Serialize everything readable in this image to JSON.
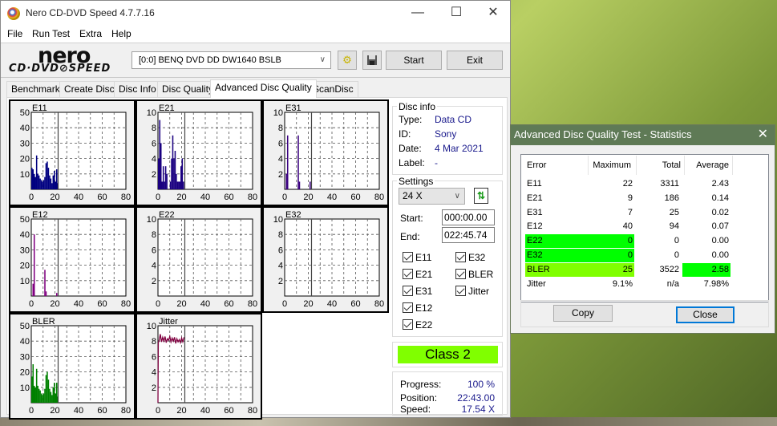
{
  "window": {
    "title": "Nero CD-DVD Speed 4.7.7.16",
    "controls": {
      "minimize": "—",
      "maximize": "☐",
      "close": "✕"
    }
  },
  "menu": [
    "File",
    "Run Test",
    "Extra",
    "Help"
  ],
  "toolbar": {
    "logo_top": "nero",
    "logo_bottom": "CD·DVD⊘SPEED",
    "drive": "[0:0]   BENQ DVD DD DW1640 BSLB",
    "icons": [
      "drive-refresh-icon",
      "save-icon"
    ],
    "start_label": "Start",
    "exit_label": "Exit"
  },
  "tabs": [
    {
      "label": "Benchmark",
      "active": false
    },
    {
      "label": "Create Disc",
      "active": false
    },
    {
      "label": "Disc Info",
      "active": false
    },
    {
      "label": "Disc Quality",
      "active": false
    },
    {
      "label": "Advanced Disc Quality",
      "active": true
    },
    {
      "label": "ScanDisc",
      "active": false
    }
  ],
  "disc_info": {
    "title": "Disc info",
    "type_label": "Type:",
    "type": "Data CD",
    "id_label": "ID:",
    "id": "Sony",
    "date_label": "Date:",
    "date": "4 Mar 2021",
    "label_label": "Label:",
    "label": "-"
  },
  "settings": {
    "title": "Settings",
    "speed": "24 X",
    "start_label": "Start:",
    "start": "000:00.00",
    "end_label": "End:",
    "end": "022:45.74",
    "checkboxes": [
      {
        "label": "E11",
        "checked": true
      },
      {
        "label": "E21",
        "checked": true
      },
      {
        "label": "E31",
        "checked": true
      },
      {
        "label": "E12",
        "checked": true
      },
      {
        "label": "E22",
        "checked": true
      },
      {
        "label": "E32",
        "checked": true
      },
      {
        "label": "BLER",
        "checked": true
      },
      {
        "label": "Jitter",
        "checked": true
      }
    ]
  },
  "class_badge": {
    "text": "Class 2",
    "color": "#80ff00"
  },
  "progress": {
    "progress_label": "Progress:",
    "progress": "100 %",
    "position_label": "Position:",
    "position": "22:43.00",
    "speed_label": "Speed:",
    "speed": "17.54 X"
  },
  "chart_data": [
    {
      "type": "bar",
      "title": "E11",
      "color": "#000080",
      "xlim": [
        0,
        80
      ],
      "ylim": [
        0,
        50
      ],
      "xticks": [
        "0",
        "20",
        "40",
        "60",
        "80"
      ],
      "yticks": [
        "10",
        "20",
        "30",
        "40",
        "50"
      ],
      "marker_x": 22.7,
      "x": [
        0,
        1,
        2,
        3,
        4,
        5,
        6,
        7,
        8,
        9,
        10,
        11,
        12,
        13,
        14,
        15,
        16,
        17,
        18,
        19,
        20,
        21,
        22
      ],
      "values": [
        14,
        13,
        10,
        8,
        22,
        10,
        9,
        7,
        6,
        5,
        6,
        8,
        17,
        18,
        14,
        9,
        7,
        4,
        9,
        12,
        5,
        13,
        4
      ]
    },
    {
      "type": "bar",
      "title": "E21",
      "color": "#1a0080",
      "xlim": [
        0,
        80
      ],
      "ylim": [
        0,
        10
      ],
      "xticks": [
        "0",
        "20",
        "40",
        "60",
        "80"
      ],
      "yticks": [
        "2",
        "4",
        "6",
        "8",
        "10"
      ],
      "marker_x": 22.7,
      "x": [
        0,
        1,
        2,
        3,
        4,
        5,
        6,
        7,
        8,
        9,
        10,
        11,
        12,
        13,
        14,
        15,
        16,
        17,
        18,
        19,
        20,
        21,
        22
      ],
      "values": [
        4,
        9,
        6,
        1,
        3,
        1,
        3,
        2,
        0,
        0,
        1,
        4,
        7,
        4,
        5,
        2,
        1,
        1,
        1,
        3,
        4,
        1,
        0
      ]
    },
    {
      "type": "bar",
      "title": "E31",
      "color": "#3a0080",
      "xlim": [
        0,
        80
      ],
      "ylim": [
        0,
        10
      ],
      "xticks": [
        "0",
        "20",
        "40",
        "60",
        "80"
      ],
      "yticks": [
        "2",
        "4",
        "6",
        "8",
        "10"
      ],
      "marker_x": 22.7,
      "x": [
        1,
        2,
        11,
        12,
        21
      ],
      "values": [
        2,
        7,
        7,
        1,
        1
      ]
    },
    {
      "type": "bar",
      "title": "E12",
      "color": "#800080",
      "xlim": [
        0,
        80
      ],
      "ylim": [
        0,
        50
      ],
      "xticks": [
        "0",
        "20",
        "40",
        "60",
        "80"
      ],
      "yticks": [
        "10",
        "20",
        "30",
        "40",
        "50"
      ],
      "marker_x": 22.7,
      "x": [
        1,
        2,
        11,
        12,
        21
      ],
      "values": [
        8,
        40,
        17,
        3,
        2
      ]
    },
    {
      "type": "bar",
      "title": "E22",
      "color": "#000080",
      "xlim": [
        0,
        80
      ],
      "ylim": [
        0,
        10
      ],
      "xticks": [
        "0",
        "20",
        "40",
        "60",
        "80"
      ],
      "yticks": [
        "2",
        "4",
        "6",
        "8",
        "10"
      ],
      "marker_x": 22.7,
      "x": [],
      "values": []
    },
    {
      "type": "bar",
      "title": "E32",
      "color": "#000080",
      "xlim": [
        0,
        80
      ],
      "ylim": [
        0,
        10
      ],
      "xticks": [
        "0",
        "20",
        "40",
        "60",
        "80"
      ],
      "yticks": [
        "2",
        "4",
        "6",
        "8",
        "10"
      ],
      "marker_x": 22.7,
      "x": [],
      "values": []
    },
    {
      "type": "bar",
      "title": "BLER",
      "color": "#008000",
      "xlim": [
        0,
        80
      ],
      "ylim": [
        0,
        50
      ],
      "xticks": [
        "0",
        "20",
        "40",
        "60",
        "80"
      ],
      "yticks": [
        "10",
        "20",
        "30",
        "40",
        "50"
      ],
      "marker_x": 22.7,
      "x": [
        0,
        1,
        2,
        3,
        4,
        5,
        6,
        7,
        8,
        9,
        10,
        11,
        12,
        13,
        14,
        15,
        16,
        17,
        18,
        19,
        20,
        21,
        22
      ],
      "values": [
        17,
        25,
        11,
        10,
        22,
        11,
        9,
        8,
        6,
        5,
        6,
        9,
        18,
        20,
        15,
        9,
        7,
        5,
        10,
        13,
        6,
        13,
        4
      ]
    },
    {
      "type": "line",
      "title": "Jitter",
      "color": "#800040",
      "xlim": [
        0,
        80
      ],
      "ylim": [
        0,
        10
      ],
      "xticks": [
        "0",
        "20",
        "40",
        "60",
        "80"
      ],
      "yticks": [
        "2",
        "4",
        "6",
        "8",
        "10"
      ],
      "marker_x": 22.7,
      "x": [
        0,
        0.3,
        1,
        2,
        3,
        4,
        5,
        6,
        7,
        8,
        9,
        10,
        11,
        12,
        13,
        14,
        15,
        16,
        17,
        18,
        19,
        20,
        21,
        22
      ],
      "values": [
        0,
        7.8,
        8.1,
        8.9,
        7.9,
        8.5,
        8.0,
        8.6,
        7.8,
        8.3,
        8.1,
        8.6,
        7.9,
        8.4,
        8.0,
        8.5,
        7.7,
        8.3,
        7.9,
        8.2,
        7.8,
        8.4,
        7.9,
        8.5
      ]
    }
  ],
  "stats_dialog": {
    "title": "Advanced Disc Quality Test - Statistics",
    "headers": [
      "Error",
      "Maximum",
      "Total",
      "Average"
    ],
    "rows": [
      {
        "name": "E11",
        "max": "22",
        "total": "3311",
        "avg": "2.43",
        "hl_max": "",
        "hl_avg": ""
      },
      {
        "name": "E21",
        "max": "9",
        "total": "186",
        "avg": "0.14",
        "hl_max": "",
        "hl_avg": ""
      },
      {
        "name": "E31",
        "max": "7",
        "total": "25",
        "avg": "0.02",
        "hl_max": "",
        "hl_avg": ""
      },
      {
        "name": "E12",
        "max": "40",
        "total": "94",
        "avg": "0.07",
        "hl_max": "",
        "hl_avg": ""
      },
      {
        "name": "E22",
        "max": "0",
        "total": "0",
        "avg": "0.00",
        "hl_max": "#00ff00",
        "hl_avg": ""
      },
      {
        "name": "E32",
        "max": "0",
        "total": "0",
        "avg": "0.00",
        "hl_max": "#00ff00",
        "hl_avg": ""
      },
      {
        "name": "BLER",
        "max": "25",
        "total": "3522",
        "avg": "2.58",
        "hl_max": "#80ff00",
        "hl_avg": "#00ff00"
      },
      {
        "name": "Jitter",
        "max": "9.1%",
        "total": "n/a",
        "avg": "7.98%",
        "hl_max": "",
        "hl_avg": ""
      }
    ],
    "copy_label": "Copy",
    "close_label": "Close"
  }
}
